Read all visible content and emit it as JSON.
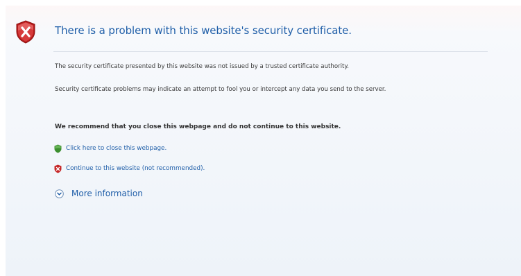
{
  "window": {
    "title": "There is a problem with this website's security certificate."
  },
  "content": {
    "paragraph_1": "The security certificate presented by this website was not issued by a trusted certificate authority.",
    "paragraph_2": "Security certificate problems may indicate an attempt to fool you or intercept any data you send to the server.",
    "recommendation": "We recommend that you close this webpage and do not continue to this website."
  },
  "actions": {
    "close_page": {
      "label": "Click here to close this webpage.",
      "icon": "green-shield-icon"
    },
    "continue": {
      "label": "Continue to this website (not recommended).",
      "icon": "red-shield-icon"
    },
    "more_info": {
      "label": "More information",
      "icon": "expand-chevron-icon"
    }
  },
  "colors": {
    "link": "#1f5ea8",
    "title": "#1f5ea8",
    "error_shield": "#c62828",
    "safe_shield": "#3c8f2f",
    "text": "#3a3a3a"
  },
  "icons": {
    "error": "error-shield-icon"
  }
}
